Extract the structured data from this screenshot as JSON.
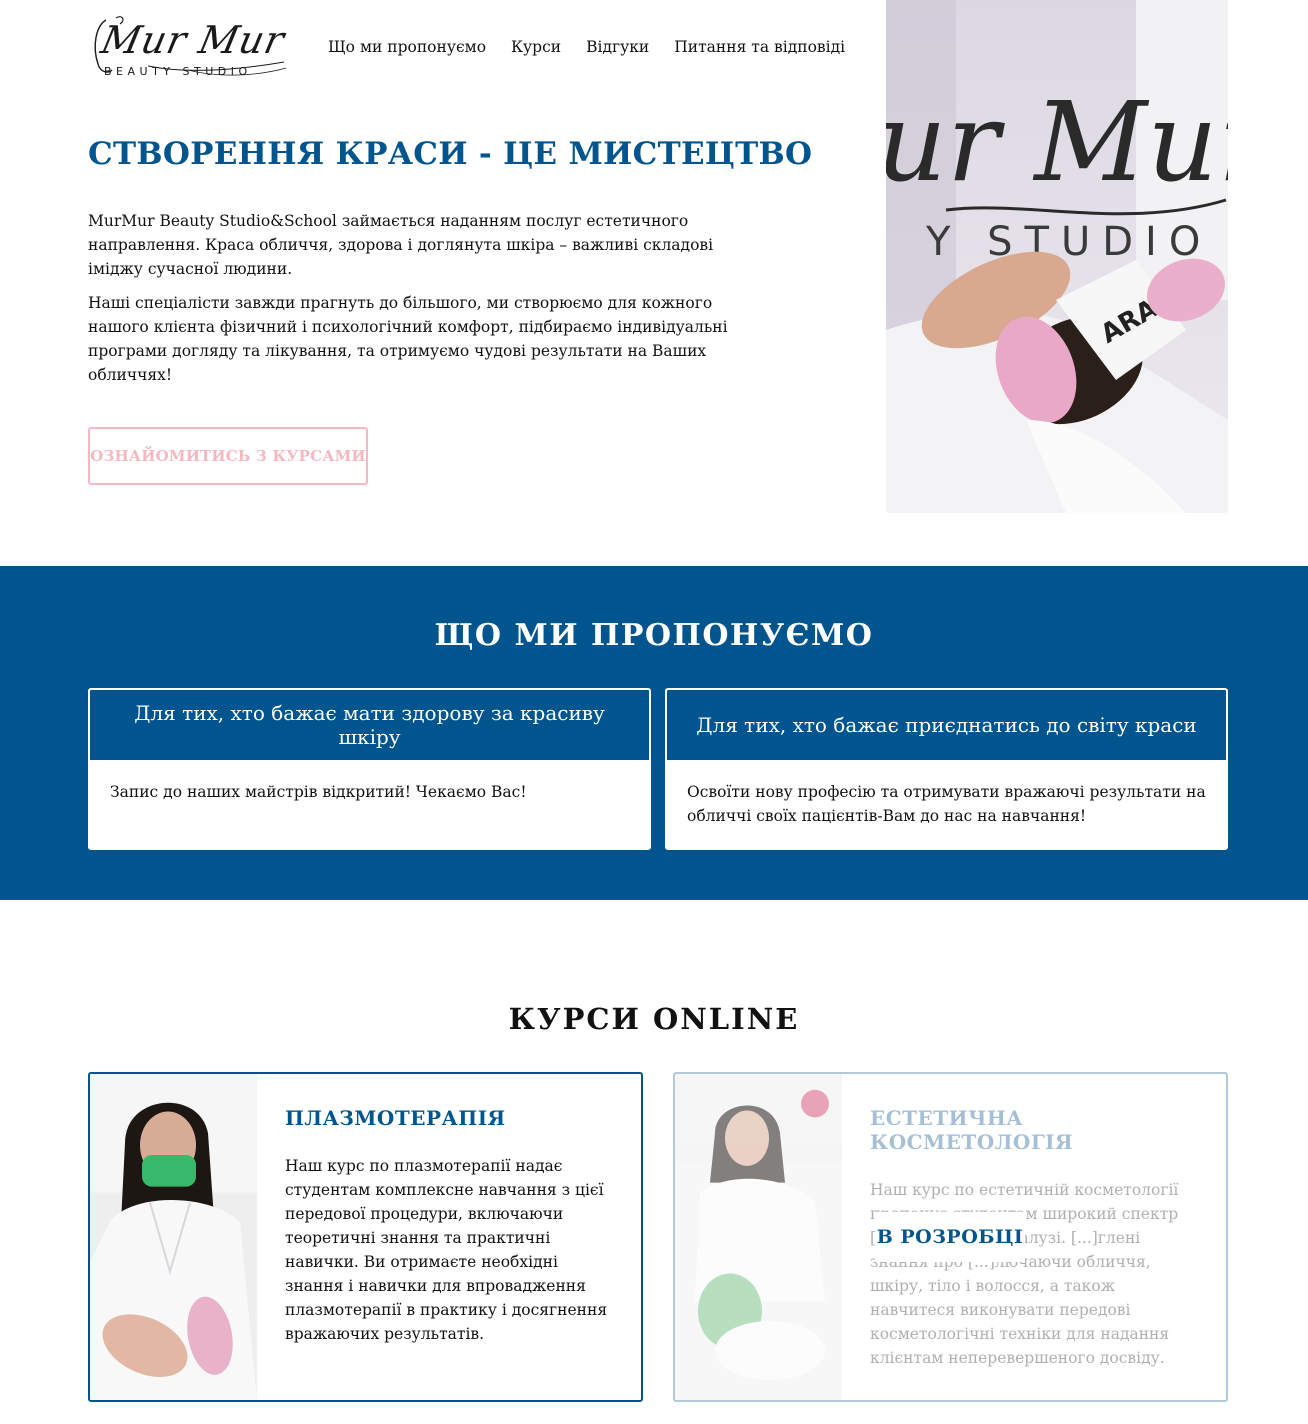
{
  "logo": {
    "script": "Mur Mur",
    "sub": "BEAUTY STUDIO"
  },
  "nav": [
    {
      "label": "Що ми пропонуємо"
    },
    {
      "label": "Курси"
    },
    {
      "label": "Відгуки"
    },
    {
      "label": "Питання та відповіді"
    }
  ],
  "hero": {
    "title": "СТВОРЕННЯ КРАСИ - ЦЕ МИСТЕЦТВО",
    "p1": "MurMur Beauty Studio&School займається наданням послуг естетичного направлення. Краса обличчя, здорова і доглянута шкіра – важливі складові іміджу сучасної людини.",
    "p2": "Наші спеціалісти завжди прагнуть до більшого, ми створюємо для кожного нашого клієнта фізичний і психологічний комфорт, підбираємо індивідуальні програми догляду та лікування, та отримуємо чудові результати на Ваших обличчях!",
    "button": "ОЗНАЙОМИТИСЬ З КУРСАМИ",
    "photo_text": "ur Mur",
    "photo_sub": "Y STUDIO",
    "photo_band": "ARA"
  },
  "offer": {
    "title": "ЩО МИ ПРОПОНУЄМО",
    "cards": [
      {
        "head": "Для тих, хто бажає мати здорову за красиву шкіру",
        "body": "Запис до наших майстрів відкритий! Чекаємо Вас!"
      },
      {
        "head": "Для тих, хто бажає приєднатись до світу краси",
        "body": "Освоїти нову професію та отримувати вражаючі результати на обличчі своїх пацієнтів-Вам до нас на навчання!"
      }
    ]
  },
  "courses": {
    "title": "КУРСИ ONLINE",
    "items": [
      {
        "name": "ПЛАЗМОТЕРАПІЯ",
        "desc": "Наш курс по плазмотерапії надає студентам комплексне навчання з цієї передової процедури, включаючи теоретичні знання та практичні навички. Ви отримаєте необхідні знання і навички для впровадження плазмотерапії в практику і досягнення вражаючих результатів."
      },
      {
        "name": "ЕСТЕТИЧНА КОСМЕТОЛОГІЯ",
        "desc": "Наш курс по естетичній косметології пропонує студентам широкий спектр [...]ровитку в цій галузі. [...]глені знання про [...]лючаючи обличчя, шкіру, тіло і волосся, а також навчитеся виконувати передові косметологічні техніки для надання клієнтам неперевершеного досвіду.",
        "badge": "В РОЗРОБЦІ"
      }
    ]
  },
  "colors": {
    "brand_blue": "#00558e",
    "accent_pink": "#f5b8c0"
  }
}
